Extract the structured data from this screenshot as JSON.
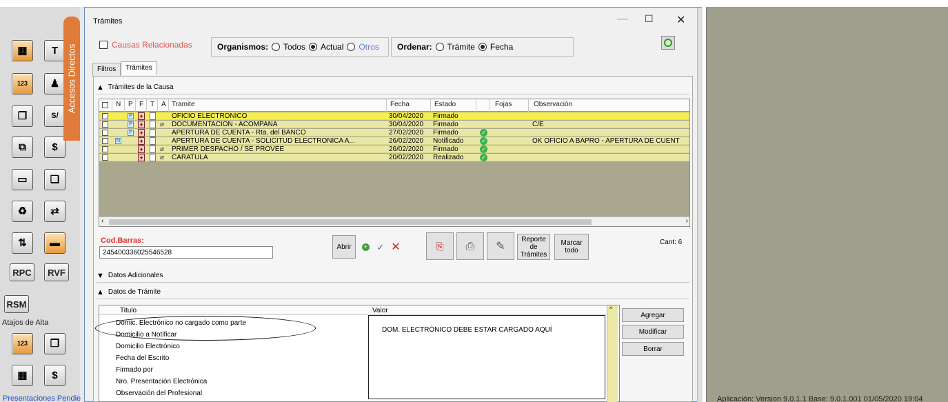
{
  "window": {
    "title": "Trámites"
  },
  "options": {
    "causas_label": "Causas Relacionadas",
    "organismos_label": "Organismos:",
    "organismos_options": [
      "Todos",
      "Actual",
      "Otros"
    ],
    "organismos_selected": "Actual",
    "ordenar_label": "Ordenar:",
    "ordenar_options": [
      "Trámite",
      "Fecha"
    ],
    "ordenar_selected": "Fecha"
  },
  "tabs": [
    "Filtros",
    "Trámites"
  ],
  "active_tab": "Trámites",
  "sections": {
    "tramites_causa": "Trámites de la Causa",
    "datos_adicionales": "Datos Adicionales",
    "datos_tramite": "Datos de Trámite"
  },
  "grid": {
    "headers": {
      "n": "N",
      "p": "P",
      "f": "F",
      "t": "T",
      "a": "A",
      "tramite": "Tramite",
      "fecha": "Fecha",
      "estado": "Estado",
      "fojas": "Fojas",
      "observacion": "Observación"
    },
    "rows": [
      {
        "tramite": "OFICIO ELECTRONICO",
        "fecha": "30/04/2020",
        "estado": "Firmado",
        "observacion": "",
        "ok": false,
        "n": false,
        "p": true,
        "clip": false,
        "selected": true
      },
      {
        "tramite": "DOCUMENTACION - ACOMPAÑA",
        "fecha": "30/04/2020",
        "estado": "Firmado",
        "observacion": "C/E",
        "ok": false,
        "n": false,
        "p": true,
        "clip": true,
        "selected": false
      },
      {
        "tramite": "APERTURA DE CUENTA - Rta. del  BANCO",
        "fecha": "27/02/2020",
        "estado": "Firmado",
        "observacion": "",
        "ok": true,
        "n": false,
        "p": true,
        "clip": false,
        "selected": false
      },
      {
        "tramite": "APERTURA DE CUENTA - SOLICITUD ELECTRONICA A...",
        "fecha": "26/02/2020",
        "estado": "Notificado",
        "observacion": "OK OFICIO A BAPRO - APERTURA DE CUENT",
        "ok": true,
        "n": true,
        "p": false,
        "clip": false,
        "selected": false
      },
      {
        "tramite": "PRIMER DESPACHO / SE PROVEE",
        "fecha": "26/02/2020",
        "estado": "Firmado",
        "observacion": "",
        "ok": true,
        "n": false,
        "p": false,
        "clip": true,
        "selected": false
      },
      {
        "tramite": "CARATULA",
        "fecha": "20/02/2020",
        "estado": "Realizado",
        "observacion": "",
        "ok": true,
        "n": false,
        "p": false,
        "clip": true,
        "selected": false
      }
    ]
  },
  "barcode": {
    "label": "Cod.Barras:",
    "value": "245400336025546528"
  },
  "buttons": {
    "abrir": "Abrir",
    "reporte": "Reporte de Trámites",
    "marcar": "Marcar todo",
    "agregar": "Agregar",
    "modificar": "Modificar",
    "borrar": "Borrar"
  },
  "count": "Cant: 6",
  "datos": {
    "col_titulo": "Titulo",
    "col_valor": "Valor",
    "rows": [
      "Domic. Electrónico no cargado como parte",
      "Domicilio a Notificar",
      "Domicilio Electrónico",
      "Fecha del Escrito",
      "Firmado por",
      "Nro. Presentación Electrónica",
      "Observación del Profesional"
    ]
  },
  "annotation": "DOM. ELECTRÓNICO DEBE ESTAR CARGADO AQUÍ",
  "left_panel": {
    "accesos": "Accesos Directos",
    "atajos": "Atajos de Alta",
    "btn_rpc": "RPC",
    "btn_rvf": "RVF",
    "btn_rsm": "RSM",
    "presentaciones": "Presentaciones Pendie"
  },
  "status": "Aplicación: Version 9.0.1.1  Base: 9.0.1.001  01/05/2020  19:04"
}
